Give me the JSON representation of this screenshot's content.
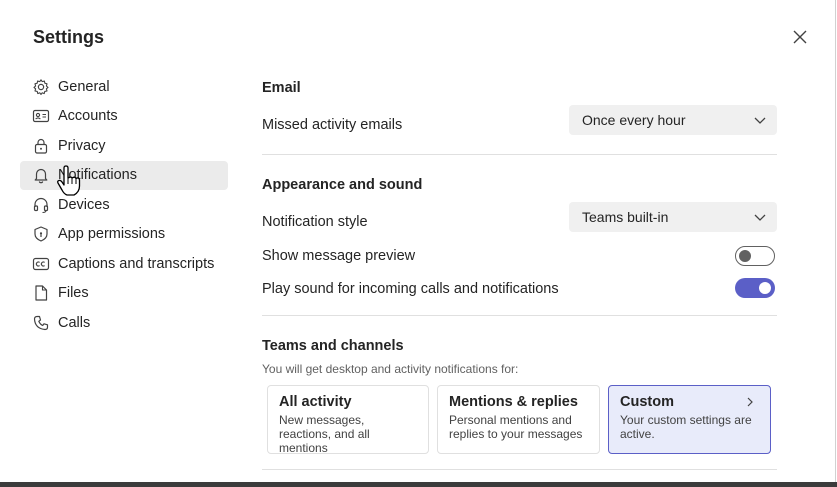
{
  "dialog": {
    "title": "Settings"
  },
  "nav": {
    "items": [
      {
        "label": "General",
        "icon": "gear-icon"
      },
      {
        "label": "Accounts",
        "icon": "id-card-icon"
      },
      {
        "label": "Privacy",
        "icon": "lock-icon"
      },
      {
        "label": "Notifications",
        "icon": "bell-icon"
      },
      {
        "label": "Devices",
        "icon": "headset-icon"
      },
      {
        "label": "App permissions",
        "icon": "shield-icon"
      },
      {
        "label": "Captions and transcripts",
        "icon": "cc-icon"
      },
      {
        "label": "Files",
        "icon": "file-icon"
      },
      {
        "label": "Calls",
        "icon": "phone-icon"
      }
    ],
    "active": "Notifications"
  },
  "email": {
    "heading": "Email",
    "missed_label": "Missed activity emails",
    "missed_value": "Once every hour"
  },
  "appearance": {
    "heading": "Appearance and sound",
    "style_label": "Notification style",
    "style_value": "Teams built-in",
    "preview_label": "Show message preview",
    "preview_on": false,
    "sound_label": "Play sound for incoming calls and notifications",
    "sound_on": true
  },
  "teams": {
    "heading": "Teams and channels",
    "subtext": "You will get desktop and activity notifications for:",
    "cards": [
      {
        "title": "All activity",
        "desc": "New messages, reactions, and all mentions"
      },
      {
        "title": "Mentions & replies",
        "desc": "Personal mentions and replies to your messages"
      },
      {
        "title": "Custom",
        "desc": "Your custom settings are active."
      }
    ],
    "selected": "Custom"
  },
  "colors": {
    "accent": "#5b5fc7",
    "selected_card_bg": "#e8ebfa",
    "nav_active_bg": "#ebebeb"
  }
}
